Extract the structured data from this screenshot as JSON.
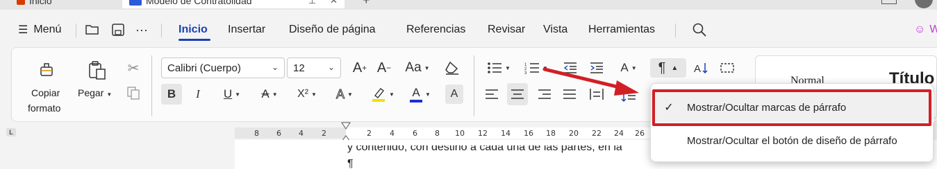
{
  "tabs": {
    "home_label": "Inicio",
    "doc_label": "Modelo de Contratolidad",
    "new_tab": "+"
  },
  "menubar": {
    "menu_label": "Menú",
    "items": [
      "Inicio",
      "Insertar",
      "Diseño de página",
      "Referencias",
      "Revisar",
      "Vista",
      "Herramientas"
    ],
    "active": "Inicio",
    "cropped_right": "W"
  },
  "ribbon": {
    "copy_format_line1": "Copiar",
    "copy_format_line2": "formato",
    "paste_label": "Pegar",
    "font_name": "Calibri (Cuerpo)",
    "font_size": "12",
    "bold": "B",
    "italic": "I",
    "underline": "U",
    "strike": "A",
    "superscript": "X²",
    "highlight_color": "#f2e000",
    "font_color": "#1b2fd6",
    "text_effects": "A",
    "text_effects_plain": "A",
    "change_case": "Aa",
    "grow_font": "A",
    "shrink_font": "A",
    "pilcrow": "¶",
    "style_normal": "Normal",
    "style_title": "Título"
  },
  "ruler": {
    "numbers": [
      "8",
      "6",
      "4",
      "2",
      "2",
      "4",
      "6",
      "8",
      "10",
      "12",
      "14",
      "16",
      "18",
      "20",
      "22",
      "24",
      "26"
    ],
    "corner": "L"
  },
  "document": {
    "line1": "y contenido, con destino a cada una de las partes, en la",
    "pilcrow": "¶"
  },
  "popup": {
    "item1": "Mostrar/Ocultar marcas de párrafo",
    "item1_checked": true,
    "item2": "Mostrar/Ocultar el botón de diseño de párrafo",
    "highlight_color": "#d11f26"
  },
  "colors": {
    "accent": "#1a3fb5",
    "arrow": "#d11f26"
  }
}
